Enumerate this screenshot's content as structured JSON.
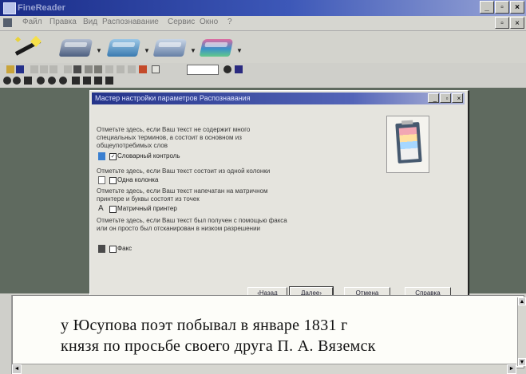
{
  "window": {
    "title": "FineReader",
    "buttons": [
      "_",
      "▫",
      "×"
    ]
  },
  "menu": [
    "Файл",
    "Правка",
    "Вид",
    "Распознавание",
    "Сервис",
    "Окно",
    "?"
  ],
  "dialog": {
    "title": "Мастер настройки параметров Распознавания",
    "title_buttons": [
      "_",
      "▫",
      "×"
    ],
    "options": [
      {
        "description": "Отметьте здесь, если Ваш текст не содержит много специальных терминов, а состоит в основном из общеупотребимых слов",
        "label": "Словарный контроль",
        "checked": true
      },
      {
        "description": "Отметьте здесь, если Ваш текст состоит из одной колонки",
        "label": "Одна колонка",
        "checked": false
      },
      {
        "description": "Отметьте здесь, если Ваш текст напечатан на матричном принтере и буквы состоят из точек",
        "label": "Матричный принтер",
        "checked": false
      },
      {
        "description": "Отметьте здесь, если Ваш текст был получен с помощью факса или он просто был отсканирован в низком разрешении",
        "label": "Факс",
        "checked": false
      }
    ],
    "buttons": {
      "back": "‹Назад",
      "next": "Далее›",
      "cancel": "Отмена",
      "help": "Справка"
    }
  },
  "document": {
    "lines": [
      "у Юсупова поэт побывал в январе 1831 г",
      "князя по просьбе своего друга П. А. Вяземск"
    ]
  }
}
